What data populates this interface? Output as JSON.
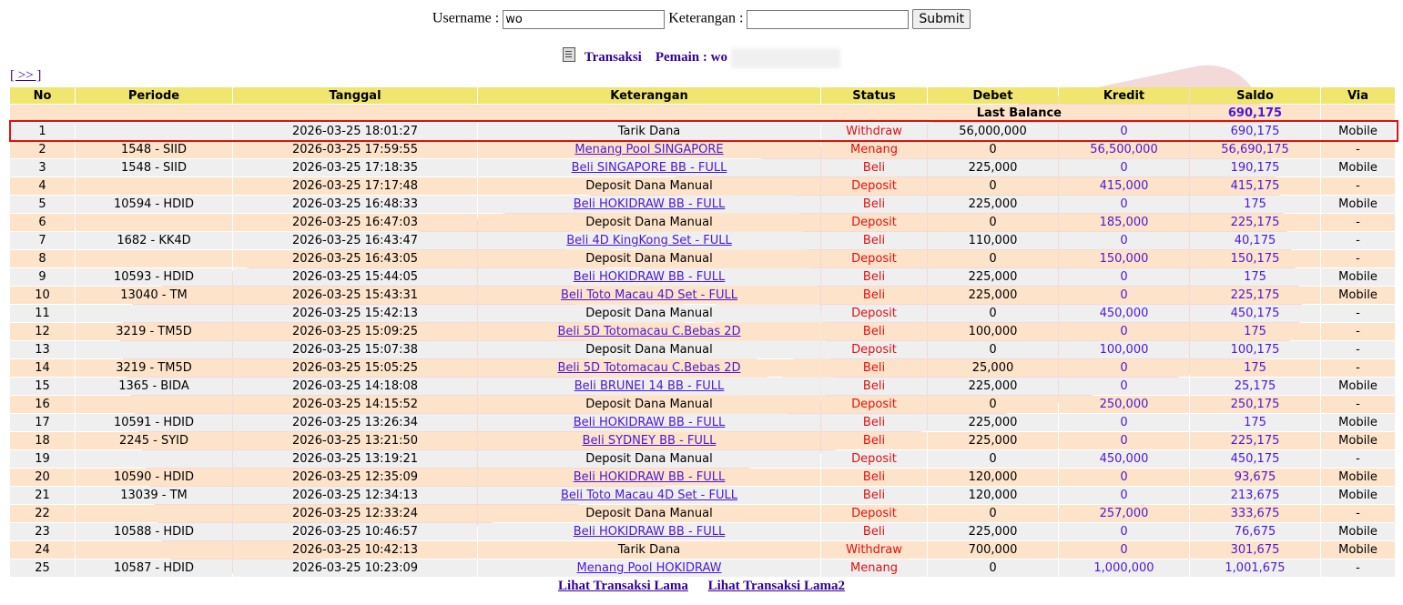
{
  "form": {
    "username_label": "Username :",
    "username_value": "wo",
    "keterangan_label": "Keterangan :",
    "keterangan_value": "",
    "submit_label": "Submit"
  },
  "title": {
    "transaksi": "Transaksi",
    "pemain_label": "Pemain : wo"
  },
  "nav": {
    "next": "[ >> ]"
  },
  "table": {
    "headers": [
      "No",
      "Periode",
      "Tanggal",
      "Keterangan",
      "Status",
      "Debet",
      "Kredit",
      "Saldo",
      "Via"
    ],
    "last_balance_label": "Last Balance",
    "last_balance_value": "690,175",
    "rows": [
      {
        "no": "1",
        "periode": "",
        "tanggal": "2026-03-25 18:01:27",
        "ket": "Tarik Dana",
        "link": false,
        "status": "Withdraw",
        "debet": "56,000,000",
        "kredit": "0",
        "saldo": "690,175",
        "via": "Mobile"
      },
      {
        "no": "2",
        "periode": "1548 - SIID",
        "tanggal": "2026-03-25 17:59:55",
        "ket": "Menang Pool SINGAPORE",
        "link": true,
        "status": "Menang",
        "debet": "0",
        "kredit": "56,500,000",
        "saldo": "56,690,175",
        "via": "-"
      },
      {
        "no": "3",
        "periode": "1548 - SIID",
        "tanggal": "2026-03-25 17:18:35",
        "ket": "Beli SINGAPORE BB - FULL",
        "link": true,
        "status": "Beli",
        "debet": "225,000",
        "kredit": "0",
        "saldo": "190,175",
        "via": "Mobile"
      },
      {
        "no": "4",
        "periode": "",
        "tanggal": "2026-03-25 17:17:48",
        "ket": "Deposit Dana Manual",
        "link": false,
        "status": "Deposit",
        "debet": "0",
        "kredit": "415,000",
        "saldo": "415,175",
        "via": "-"
      },
      {
        "no": "5",
        "periode": "10594 - HDID",
        "tanggal": "2026-03-25 16:48:33",
        "ket": "Beli HOKIDRAW BB - FULL",
        "link": true,
        "status": "Beli",
        "debet": "225,000",
        "kredit": "0",
        "saldo": "175",
        "via": "Mobile"
      },
      {
        "no": "6",
        "periode": "",
        "tanggal": "2026-03-25 16:47:03",
        "ket": "Deposit Dana Manual",
        "link": false,
        "status": "Deposit",
        "debet": "0",
        "kredit": "185,000",
        "saldo": "225,175",
        "via": "-"
      },
      {
        "no": "7",
        "periode": "1682 - KK4D",
        "tanggal": "2026-03-25 16:43:47",
        "ket": "Beli 4D KingKong Set - FULL",
        "link": true,
        "status": "Beli",
        "debet": "110,000",
        "kredit": "0",
        "saldo": "40,175",
        "via": "-"
      },
      {
        "no": "8",
        "periode": "",
        "tanggal": "2026-03-25 16:43:05",
        "ket": "Deposit Dana Manual",
        "link": false,
        "status": "Deposit",
        "debet": "0",
        "kredit": "150,000",
        "saldo": "150,175",
        "via": "-"
      },
      {
        "no": "9",
        "periode": "10593 - HDID",
        "tanggal": "2026-03-25 15:44:05",
        "ket": "Beli HOKIDRAW BB - FULL",
        "link": true,
        "status": "Beli",
        "debet": "225,000",
        "kredit": "0",
        "saldo": "175",
        "via": "Mobile"
      },
      {
        "no": "10",
        "periode": "13040 - TM",
        "tanggal": "2026-03-25 15:43:31",
        "ket": "Beli Toto Macau 4D Set - FULL",
        "link": true,
        "status": "Beli",
        "debet": "225,000",
        "kredit": "0",
        "saldo": "225,175",
        "via": "Mobile"
      },
      {
        "no": "11",
        "periode": "",
        "tanggal": "2026-03-25 15:42:13",
        "ket": "Deposit Dana Manual",
        "link": false,
        "status": "Deposit",
        "debet": "0",
        "kredit": "450,000",
        "saldo": "450,175",
        "via": "-"
      },
      {
        "no": "12",
        "periode": "3219 - TM5D",
        "tanggal": "2026-03-25 15:09:25",
        "ket": "Beli 5D Totomacau C.Bebas 2D",
        "link": true,
        "status": "Beli",
        "debet": "100,000",
        "kredit": "0",
        "saldo": "175",
        "via": "-"
      },
      {
        "no": "13",
        "periode": "",
        "tanggal": "2026-03-25 15:07:38",
        "ket": "Deposit Dana Manual",
        "link": false,
        "status": "Deposit",
        "debet": "0",
        "kredit": "100,000",
        "saldo": "100,175",
        "via": "-"
      },
      {
        "no": "14",
        "periode": "3219 - TM5D",
        "tanggal": "2026-03-25 15:05:25",
        "ket": "Beli 5D Totomacau C.Bebas 2D",
        "link": true,
        "status": "Beli",
        "debet": "25,000",
        "kredit": "0",
        "saldo": "175",
        "via": "-"
      },
      {
        "no": "15",
        "periode": "1365 - BIDA",
        "tanggal": "2026-03-25 14:18:08",
        "ket": "Beli BRUNEI 14 BB - FULL",
        "link": true,
        "status": "Beli",
        "debet": "225,000",
        "kredit": "0",
        "saldo": "25,175",
        "via": "Mobile"
      },
      {
        "no": "16",
        "periode": "",
        "tanggal": "2026-03-25 14:15:52",
        "ket": "Deposit Dana Manual",
        "link": false,
        "status": "Deposit",
        "debet": "0",
        "kredit": "250,000",
        "saldo": "250,175",
        "via": "-"
      },
      {
        "no": "17",
        "periode": "10591 - HDID",
        "tanggal": "2026-03-25 13:26:34",
        "ket": "Beli HOKIDRAW BB - FULL",
        "link": true,
        "status": "Beli",
        "debet": "225,000",
        "kredit": "0",
        "saldo": "175",
        "via": "Mobile"
      },
      {
        "no": "18",
        "periode": "2245 - SYID",
        "tanggal": "2026-03-25 13:21:50",
        "ket": "Beli SYDNEY BB - FULL",
        "link": true,
        "status": "Beli",
        "debet": "225,000",
        "kredit": "0",
        "saldo": "225,175",
        "via": "Mobile"
      },
      {
        "no": "19",
        "periode": "",
        "tanggal": "2026-03-25 13:19:21",
        "ket": "Deposit Dana Manual",
        "link": false,
        "status": "Deposit",
        "debet": "0",
        "kredit": "450,000",
        "saldo": "450,175",
        "via": "-"
      },
      {
        "no": "20",
        "periode": "10590 - HDID",
        "tanggal": "2026-03-25 12:35:09",
        "ket": "Beli HOKIDRAW BB - FULL",
        "link": true,
        "status": "Beli",
        "debet": "120,000",
        "kredit": "0",
        "saldo": "93,675",
        "via": "Mobile"
      },
      {
        "no": "21",
        "periode": "13039 - TM",
        "tanggal": "2026-03-25 12:34:13",
        "ket": "Beli Toto Macau 4D Set - FULL",
        "link": true,
        "status": "Beli",
        "debet": "120,000",
        "kredit": "0",
        "saldo": "213,675",
        "via": "Mobile"
      },
      {
        "no": "22",
        "periode": "",
        "tanggal": "2026-03-25 12:33:24",
        "ket": "Deposit Dana Manual",
        "link": false,
        "status": "Deposit",
        "debet": "0",
        "kredit": "257,000",
        "saldo": "333,675",
        "via": "-"
      },
      {
        "no": "23",
        "periode": "10588 - HDID",
        "tanggal": "2026-03-25 10:46:57",
        "ket": "Beli HOKIDRAW BB - FULL",
        "link": true,
        "status": "Beli",
        "debet": "225,000",
        "kredit": "0",
        "saldo": "76,675",
        "via": "Mobile"
      },
      {
        "no": "24",
        "periode": "",
        "tanggal": "2026-03-25 10:42:13",
        "ket": "Tarik Dana",
        "link": false,
        "status": "Withdraw",
        "debet": "700,000",
        "kredit": "0",
        "saldo": "301,675",
        "via": "Mobile"
      },
      {
        "no": "25",
        "periode": "10587 - HDID",
        "tanggal": "2026-03-25 10:23:09",
        "ket": "Menang Pool HOKIDRAW",
        "link": true,
        "status": "Menang",
        "debet": "0",
        "kredit": "1,000,000",
        "saldo": "1,001,675",
        "via": "-"
      }
    ]
  },
  "footer": {
    "link1": "Lihat Transaksi Lama",
    "link2": "Lihat Transaksi Lama2"
  },
  "colors": {
    "header_bg": "#f0e56e",
    "row_odd": "#efefef",
    "row_even": "#fde3c9",
    "status_red": "#e01010",
    "link_purple": "#4b19d6",
    "highlight_border": "#e01010"
  }
}
